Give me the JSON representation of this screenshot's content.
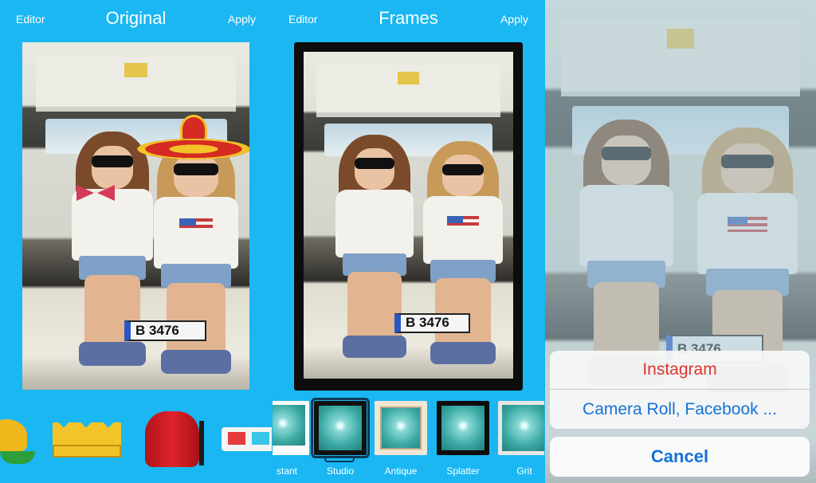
{
  "screens": [
    {
      "name": "editor",
      "nav": {
        "left": "Editor",
        "title": "Original",
        "right": "Apply"
      },
      "plate": "B 3476",
      "stickers": [
        "hat-icon",
        "crown-icon",
        "fez-icon",
        "3d-glasses-icon"
      ]
    },
    {
      "name": "frames",
      "nav": {
        "left": "Editor",
        "title": "Frames",
        "right": "Apply"
      },
      "plate": "B 3476",
      "frames": [
        {
          "label": "stant",
          "style": "instant"
        },
        {
          "label": "Studio",
          "style": "studio",
          "selected": true
        },
        {
          "label": "Antique",
          "style": "antique"
        },
        {
          "label": "Splatter",
          "style": "splatter"
        },
        {
          "label": "Grit",
          "style": "grit"
        }
      ]
    },
    {
      "name": "share",
      "plate": "B 3476",
      "action_sheet": {
        "options": [
          "Instagram",
          "Camera Roll, Facebook ..."
        ],
        "cancel": "Cancel"
      }
    }
  ],
  "colors": {
    "background": "#1ab7f2",
    "destructive": "#e0332e",
    "action": "#1572d6"
  }
}
